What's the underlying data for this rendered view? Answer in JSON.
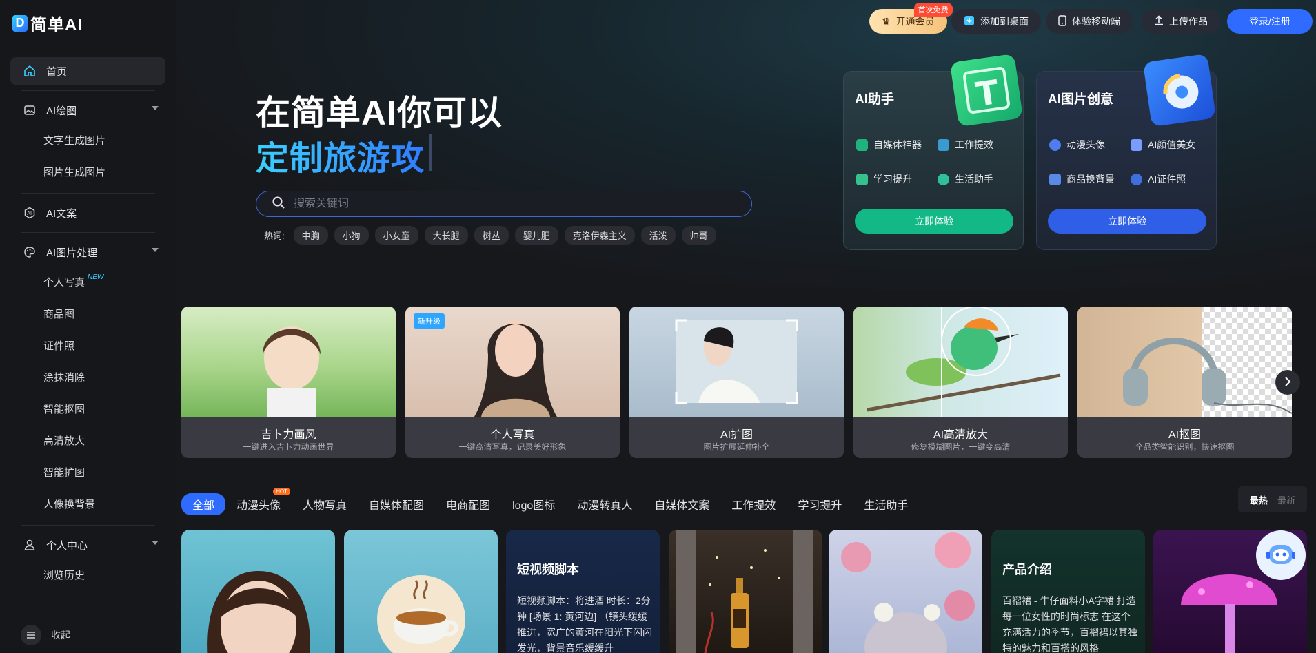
{
  "brand": {
    "logo_letter": "D",
    "name": "简单AI"
  },
  "header": {
    "vip_label": "开通会员",
    "vip_tag": "首次免费",
    "desktop_label": "添加到桌面",
    "mobile_label": "体验移动端",
    "upload_label": "上传作品",
    "login_label": "登录/注册"
  },
  "sidebar": {
    "home": "首页",
    "ai_draw": "AI绘图",
    "ai_draw_items": [
      "文字生成图片",
      "图片生成图片"
    ],
    "ai_copy": "AI文案",
    "ai_image": "AI图片处理",
    "ai_image_items": [
      "个人写真",
      "商品图",
      "证件照",
      "涂抹消除",
      "智能抠图",
      "高清放大",
      "智能扩图",
      "人像换背景"
    ],
    "new_tag": "NEW",
    "personal": "个人中心",
    "personal_items": [
      "浏览历史"
    ],
    "collapse": "收起"
  },
  "hero": {
    "title": "在简单AI你可以",
    "subtitle": "定制旅游攻",
    "search_placeholder": "搜索关键词",
    "hot_label": "热词:",
    "hot_words": [
      "中胸",
      "小狗",
      "小女童",
      "大长腿",
      "树丛",
      "婴儿肥",
      "克洛伊森主义",
      "活泼",
      "帅哥"
    ]
  },
  "assistant_card": {
    "title": "AI助手",
    "items": [
      "自媒体神器",
      "工作提效",
      "学习提升",
      "生活助手"
    ],
    "button": "立即体验"
  },
  "creative_card": {
    "title": "AI图片创意",
    "items": [
      "动漫头像",
      "AI颜值美女",
      "商品换背景",
      "AI证件照"
    ],
    "button": "立即体验"
  },
  "features": [
    {
      "title": "吉卜力画风",
      "desc": "一键进入吉卜力动画世界"
    },
    {
      "title": "个人写真",
      "desc": "一键高清写真，记录美好形象",
      "badge": "新升级"
    },
    {
      "title": "AI扩图",
      "desc": "图片扩展延伸补全"
    },
    {
      "title": "AI高清放大",
      "desc": "修复模糊图片，一键变高清"
    },
    {
      "title": "AI抠图",
      "desc": "全品类智能识别，快速抠图"
    }
  ],
  "categories": [
    "全部",
    "动漫头像",
    "人物写真",
    "自媒体配图",
    "电商配图",
    "logo图标",
    "动漫转真人",
    "自媒体文案",
    "工作提效",
    "学习提升",
    "生活助手"
  ],
  "hot_badge": "HOT",
  "sort": {
    "latest_hot": "最热",
    "latest_new": "最新"
  },
  "gallery": {
    "script_title": "短视频脚本",
    "script_text": "短视频脚本：将进酒 时长：2分钟 [场景 1: 黄河边] （镜头缓缓推进，宽广的黄河在阳光下闪闪发光，背景音乐缓缓升",
    "product_title": "产品介绍",
    "product_text": "百褶裙 - 牛仔面料小A字裙 打造每一位女性的时尚标志 在这个充满活力的季节，百褶裙以其独特的魅力和百搭的风格"
  },
  "colors": {
    "accent": "#2f6bff",
    "teal": "#12b886",
    "hot": "#ff6d1f"
  }
}
